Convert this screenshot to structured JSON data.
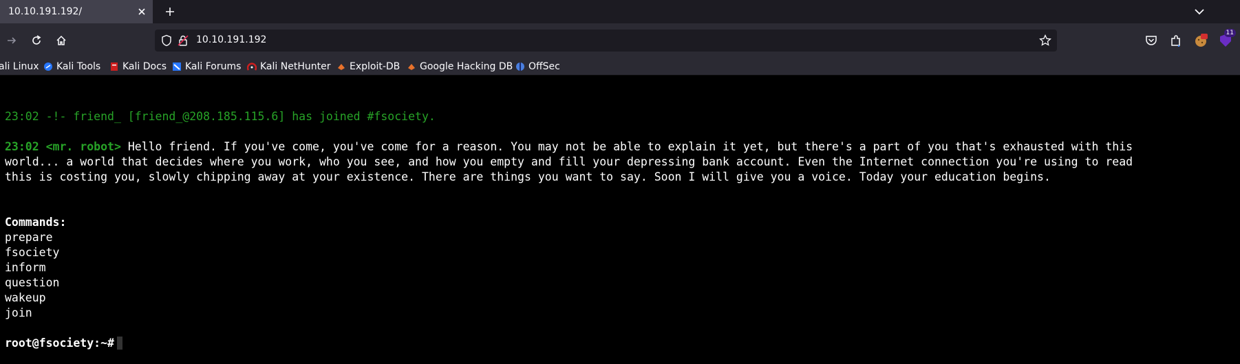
{
  "browser": {
    "tab": {
      "title": "10.10.191.192/"
    },
    "url": "10.10.191.192",
    "extension_badge": "11",
    "bookmarks": [
      {
        "label": "ali Linux",
        "icon": "kali-linux-icon",
        "color": "#2777ff"
      },
      {
        "label": "Kali Tools",
        "icon": "kali-tools-icon",
        "color": "#2777ff"
      },
      {
        "label": "Kali Docs",
        "icon": "kali-docs-icon",
        "color": "#cc1f1f"
      },
      {
        "label": "Kali Forums",
        "icon": "kali-forums-icon",
        "color": "#2777ff"
      },
      {
        "label": "Kali NetHunter",
        "icon": "kali-nethunter-icon",
        "color": "#cc1f1f"
      },
      {
        "label": "Exploit-DB",
        "icon": "exploit-db-icon",
        "color": "#e8722b"
      },
      {
        "label": "Google Hacking DB",
        "icon": "ghdb-icon",
        "color": "#e8722b"
      },
      {
        "label": "OffSec",
        "icon": "offsec-icon",
        "color": "#4a7fe0"
      }
    ]
  },
  "terminal": {
    "join_line": "23:02 -!- friend_ [friend_@208.185.115.6] has joined #fsociety.",
    "msg_prefix": "23:02 <mr. robot>",
    "msg_line1": " Hello friend. If you've come, you've come for a reason. You may not be able to explain it yet, but there's a part of you that's exhausted with this",
    "msg_line2": "world... a world that decides where you work, who you see, and how you empty and fill your depressing bank account. Even the Internet connection you're using to read",
    "msg_line3": "this is costing you, slowly chipping away at your existence. There are things you want to say. Soon I will give you a voice. Today your education begins.",
    "commands_header": "Commands:",
    "commands": [
      "prepare",
      "fsociety",
      "inform",
      "question",
      "wakeup",
      "join"
    ],
    "prompt": "root@fsociety:~#"
  },
  "colors": {
    "irc_green": "#27a327",
    "tabbar_bg": "#1c1b22",
    "toolbar_bg": "#2b2a33"
  }
}
